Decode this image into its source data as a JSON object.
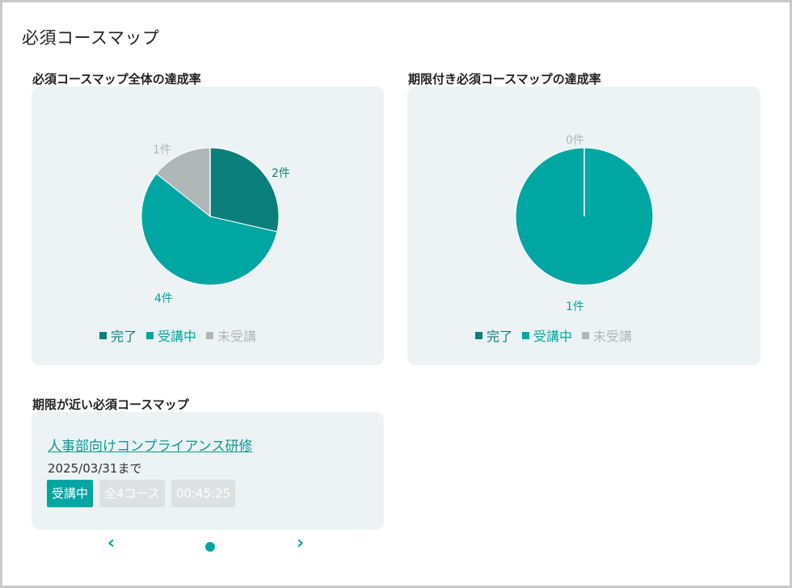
{
  "page": {
    "title": "必須コースマップ"
  },
  "legend": {
    "items": [
      {
        "label": "完了",
        "color": "#0b7f7b"
      },
      {
        "label": "受講中",
        "color": "#00a6a2"
      },
      {
        "label": "未受講",
        "color": "#b1b6b7"
      }
    ]
  },
  "overall": {
    "title": "必須コースマップ全体の達成率",
    "labels": {
      "completed": "2件",
      "in_progress": "4件",
      "not_started": "1件"
    }
  },
  "deadline": {
    "title": "期限付き必須コースマップの達成率",
    "labels": {
      "completed": "0件",
      "in_progress": "1件"
    }
  },
  "upcoming": {
    "title": "期限が近い必須コースマップ",
    "course_name": "人事部向けコンプライアンス研修",
    "due": "2025/03/31まで",
    "status": "受講中",
    "course_count": "全4コース",
    "duration": "00:45:25"
  },
  "carousel": {
    "prev_icon": "chevron-left-icon",
    "next_icon": "chevron-right-icon",
    "prev": "‹",
    "next": "›"
  },
  "chart_data": [
    {
      "type": "pie",
      "title": "必須コースマップ全体の達成率",
      "categories": [
        "完了",
        "受講中",
        "未受講"
      ],
      "values": [
        2,
        4,
        1
      ],
      "colors": [
        "#0b7f7b",
        "#00a6a2",
        "#b1b6b7"
      ],
      "data_labels": [
        "2件",
        "4件",
        "1件"
      ],
      "legend": "bottom"
    },
    {
      "type": "pie",
      "title": "期限付き必須コースマップの達成率",
      "categories": [
        "完了",
        "受講中",
        "未受講"
      ],
      "values": [
        0,
        1,
        0
      ],
      "colors": [
        "#0b7f7b",
        "#00a6a2",
        "#b1b6b7"
      ],
      "data_labels": [
        "0件",
        "1件"
      ],
      "legend": "bottom"
    }
  ]
}
